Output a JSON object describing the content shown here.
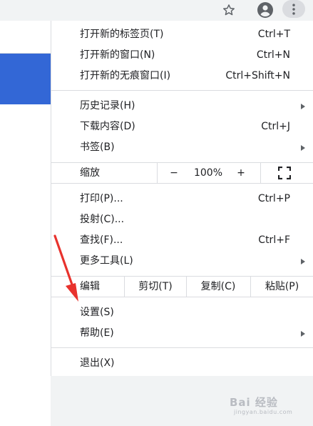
{
  "toolbar": {
    "icons": [
      "star-icon",
      "account-icon",
      "more-vert-icon"
    ]
  },
  "menu": {
    "new_tab": {
      "label": "打开新的标签页(T)",
      "shortcut": "Ctrl+T"
    },
    "new_window": {
      "label": "打开新的窗口(N)",
      "shortcut": "Ctrl+N"
    },
    "new_incognito": {
      "label": "打开新的无痕窗口(I)",
      "shortcut": "Ctrl+Shift+N"
    },
    "history": {
      "label": "历史记录(H)"
    },
    "downloads": {
      "label": "下载内容(D)",
      "shortcut": "Ctrl+J"
    },
    "bookmarks": {
      "label": "书签(B)"
    },
    "zoom": {
      "label": "缩放",
      "minus": "−",
      "value": "100%",
      "plus": "+"
    },
    "print": {
      "label": "打印(P)...",
      "shortcut": "Ctrl+P"
    },
    "cast": {
      "label": "投射(C)..."
    },
    "find": {
      "label": "查找(F)...",
      "shortcut": "Ctrl+F"
    },
    "more_tools": {
      "label": "更多工具(L)"
    },
    "edit": {
      "label": "编辑",
      "cut": "剪切(T)",
      "copy": "复制(C)",
      "paste": "粘贴(P)"
    },
    "settings": {
      "label": "设置(S)"
    },
    "help": {
      "label": "帮助(E)"
    },
    "exit": {
      "label": "退出(X)"
    }
  },
  "colors": {
    "accent_blue": "#3367d6",
    "annotation_red": "#e8322d"
  },
  "watermark": {
    "text": "Bai 经验",
    "subtext": "jingyan.baidu.com"
  }
}
